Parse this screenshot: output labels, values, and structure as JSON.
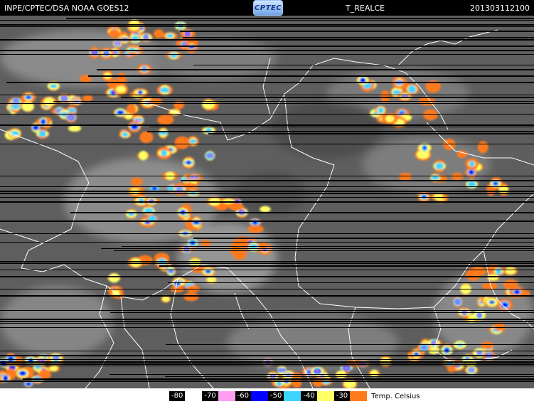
{
  "header": {
    "left_label": "INPE/CPTEC/DSA NOAA GOES12",
    "logo_text": "CPTEC",
    "center_label": "T_REALCE",
    "timestamp": "201303112100"
  },
  "legend": {
    "items": [
      {
        "value": "-80",
        "color": "#ffffff"
      },
      {
        "value": "-70",
        "color": "#ff9ef0"
      },
      {
        "value": "-60",
        "color": "#0000ff"
      },
      {
        "value": "-50",
        "color": "#3cd4ff"
      },
      {
        "value": "-40",
        "color": "#ffff66"
      },
      {
        "value": "-30",
        "color": "#ff7a1a"
      }
    ],
    "unit": "Temp. Celsius"
  },
  "colors": {
    "background_clouds": "#6a6a6a",
    "borders": "#ffffff",
    "scanlines": "#000000"
  }
}
